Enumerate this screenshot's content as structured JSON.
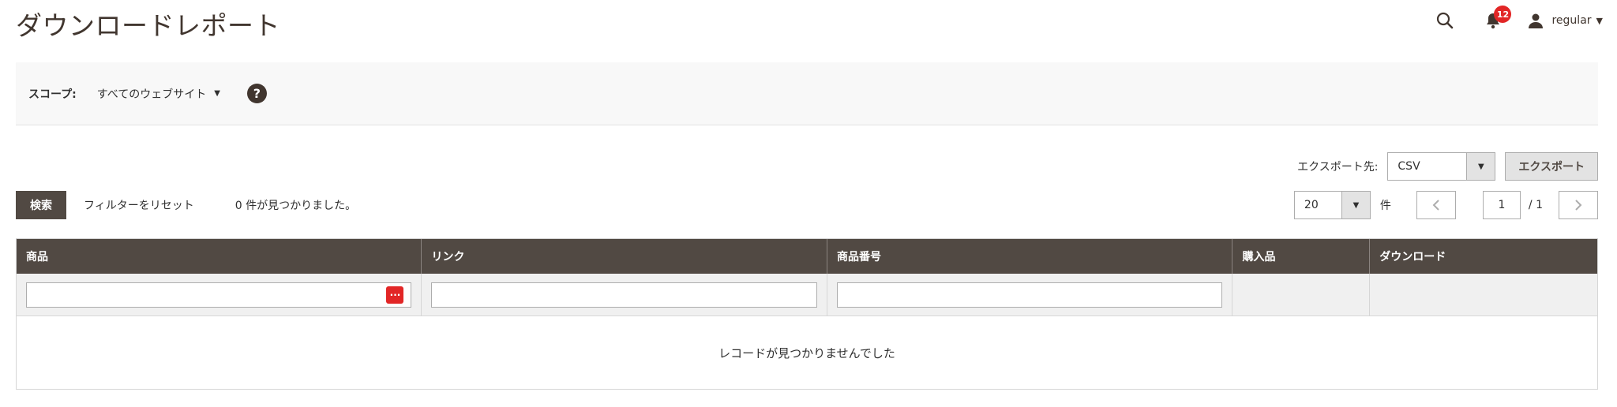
{
  "page": {
    "title": "ダウンロードレポート"
  },
  "header": {
    "notifications_count": "12",
    "user_name": "regular"
  },
  "scope": {
    "label": "スコープ:",
    "selected": "すべてのウェブサイト",
    "help_symbol": "?"
  },
  "export": {
    "label": "エクスポート先:",
    "format": "CSV",
    "button_label": "エクスポート"
  },
  "toolbar": {
    "search_label": "検索",
    "reset_label": "フィルターをリセット",
    "records_found": "0 件が見つかりました。",
    "per_page": "20",
    "per_page_label": "件",
    "current_page": "1",
    "total_pages": "/ 1"
  },
  "grid": {
    "columns": [
      "商品",
      "リンク",
      "商品番号",
      "購入品",
      "ダウンロード"
    ],
    "empty_message": "レコードが見つかりませんでした"
  },
  "colors": {
    "header_bg": "#514943",
    "badge": "#e22626",
    "scope_bg": "#f8f8f8"
  }
}
